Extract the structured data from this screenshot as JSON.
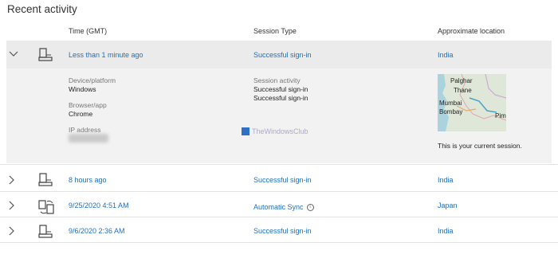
{
  "heading": "Recent activity",
  "columns": {
    "time": "Time (GMT)",
    "session": "Session Type",
    "location": "Approximate location"
  },
  "rows": [
    {
      "time": "Less than 1 minute ago",
      "session": "Successful sign-in",
      "location": "India",
      "device_icon": "computer-icon",
      "expanded": true
    },
    {
      "time": "8 hours ago",
      "session": "Successful sign-in",
      "location": "India",
      "device_icon": "computer-icon",
      "expanded": false
    },
    {
      "time": "9/25/2020 4:51 AM",
      "session": "Automatic Sync",
      "location": "Japan",
      "device_icon": "sync-device-icon",
      "expanded": false
    },
    {
      "time": "9/6/2020 2:36 AM",
      "session": "Successful sign-in",
      "location": "India",
      "device_icon": "computer-icon",
      "expanded": false
    }
  ],
  "details": {
    "device_label": "Device/platform",
    "device_value": "Windows",
    "browser_label": "Browser/app",
    "browser_value": "Chrome",
    "ip_label": "IP address",
    "activity_label": "Session activity",
    "activity_items": [
      "Successful sign-in",
      "Successful sign-in"
    ],
    "current_session": "This is your current session.",
    "map_labels": [
      "Palghar",
      "Thane",
      "Mumbai",
      "Bombay",
      "Pim"
    ]
  },
  "watermark": "TheWindowsClub",
  "colors": {
    "link": "#1f6fbf",
    "expanded_bg": "#f2f2f2"
  }
}
